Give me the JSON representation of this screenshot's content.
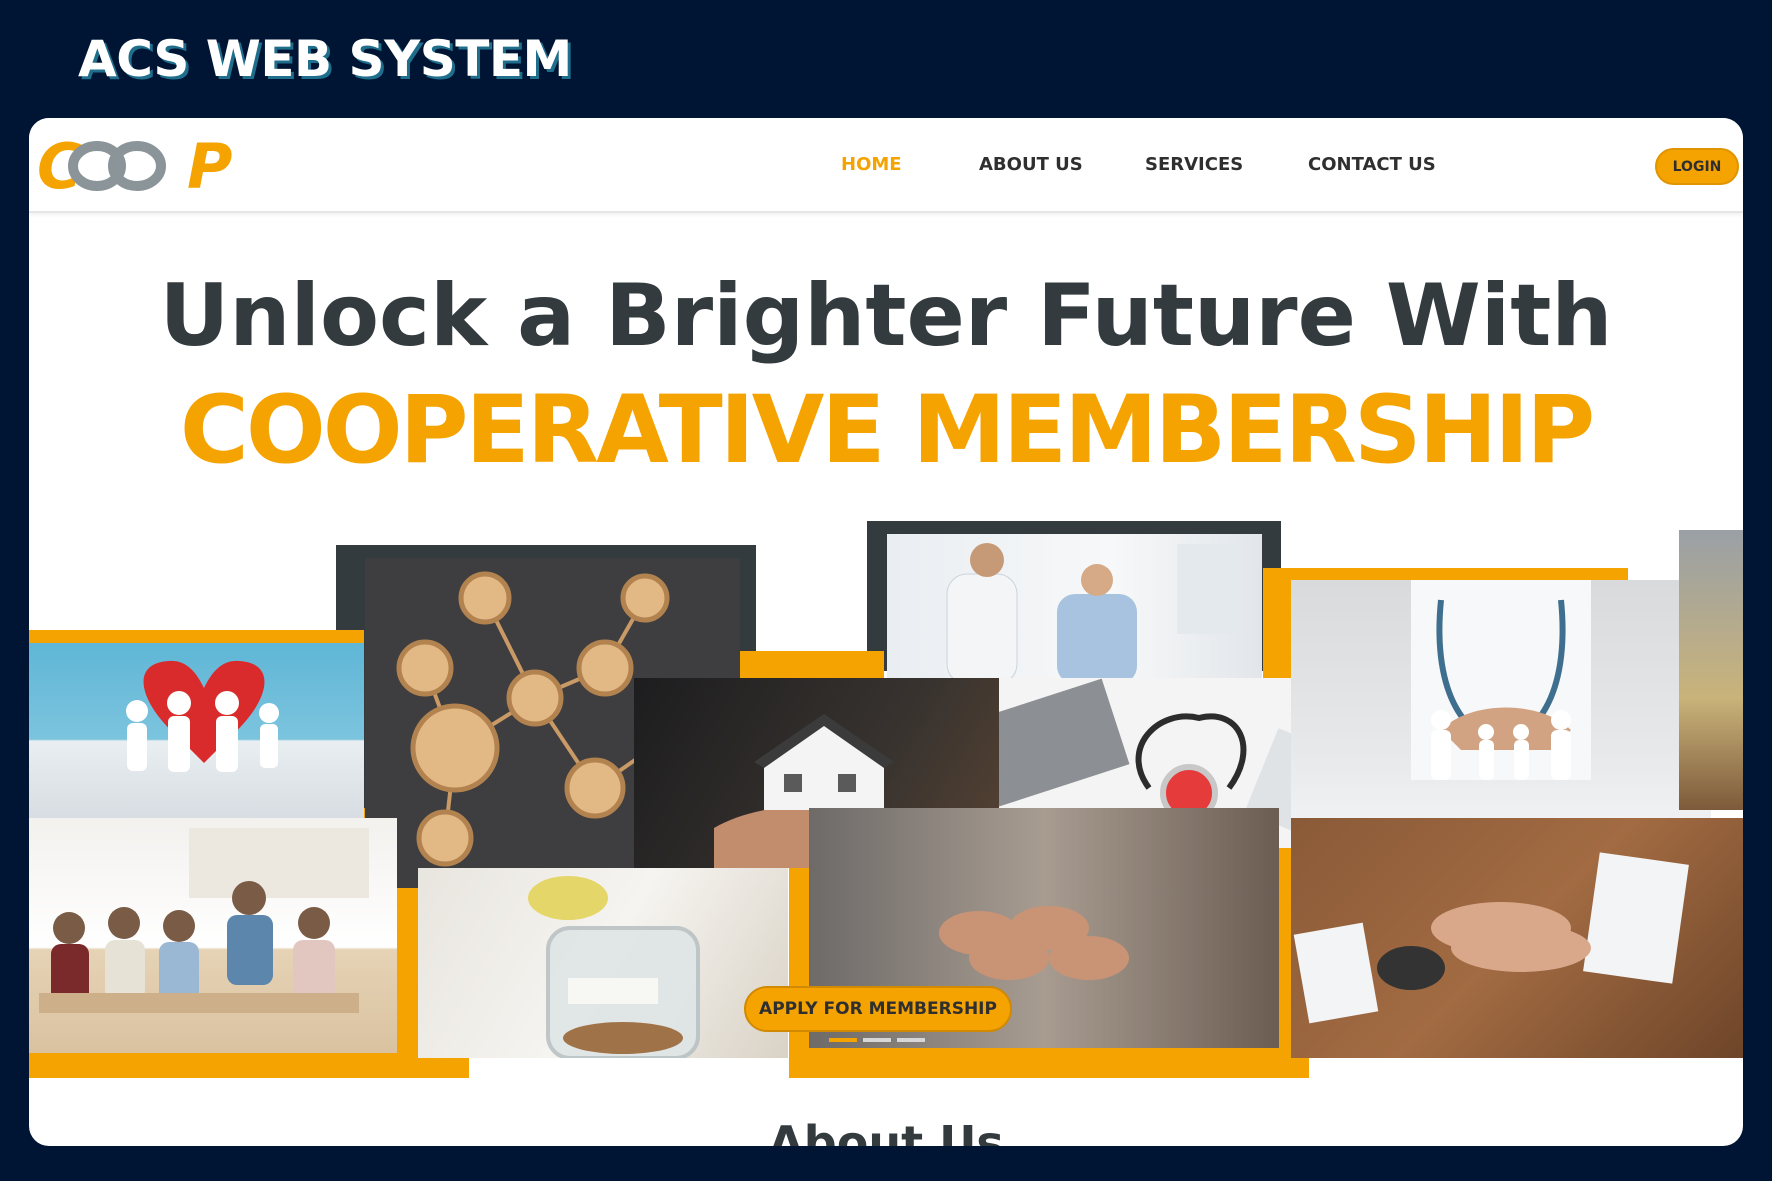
{
  "page_heading": "ACS WEB SYSTEM",
  "site": {
    "logo_text": "COOP",
    "nav": [
      {
        "label": "HOME",
        "active": true
      },
      {
        "label": "ABOUT US",
        "active": false
      },
      {
        "label": "SERVICES",
        "active": false
      },
      {
        "label": "CONTACT US",
        "active": false
      }
    ],
    "login_label": "LOGIN"
  },
  "hero": {
    "title_line1": "Unlock a Brighter Future With",
    "title_line2": "COOPERATIVE MEMBERSHIP",
    "apply_label": "APPLY FOR MEMBERSHIP",
    "slide_indicator": {
      "count": 3,
      "active_index": 0
    }
  },
  "collage_images": [
    "paper family with red heart",
    "wooden network of people icons",
    "doctor consulting patient",
    "hand holding small house model",
    "stethoscope with heart on desk",
    "doctor with paper family cutout",
    "students studying at table",
    "retirement savings jar",
    "fist bump team",
    "stacked hands over desk"
  ],
  "about_heading": "About Us",
  "colors": {
    "accent": "#f5a300",
    "dark_text": "#333b3e",
    "background": "#001433",
    "frame_dark": "#333b3e"
  }
}
